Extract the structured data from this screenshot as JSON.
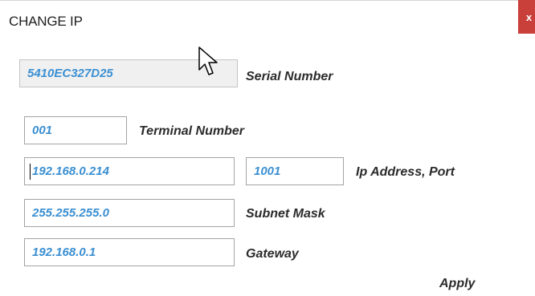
{
  "dialog": {
    "title": "CHANGE IP",
    "close_label": "x"
  },
  "serial": {
    "value": "5410EC327D25",
    "label": "Serial Number"
  },
  "terminal": {
    "value": "001",
    "label": "Terminal Number"
  },
  "ip": {
    "value": "192.168.0.214",
    "port": "1001",
    "label": "Ip Address, Port"
  },
  "subnet": {
    "value": "255.255.255.0",
    "label": "Subnet Mask"
  },
  "gateway": {
    "value": "192.168.0.1",
    "label": "Gateway"
  },
  "apply_label": "Apply",
  "colors": {
    "close_bg": "#c9403b",
    "field_text": "#3a8fd2",
    "label_text": "#2b2b2b"
  },
  "icons": {
    "cursor": "mouse-pointer-icon"
  }
}
